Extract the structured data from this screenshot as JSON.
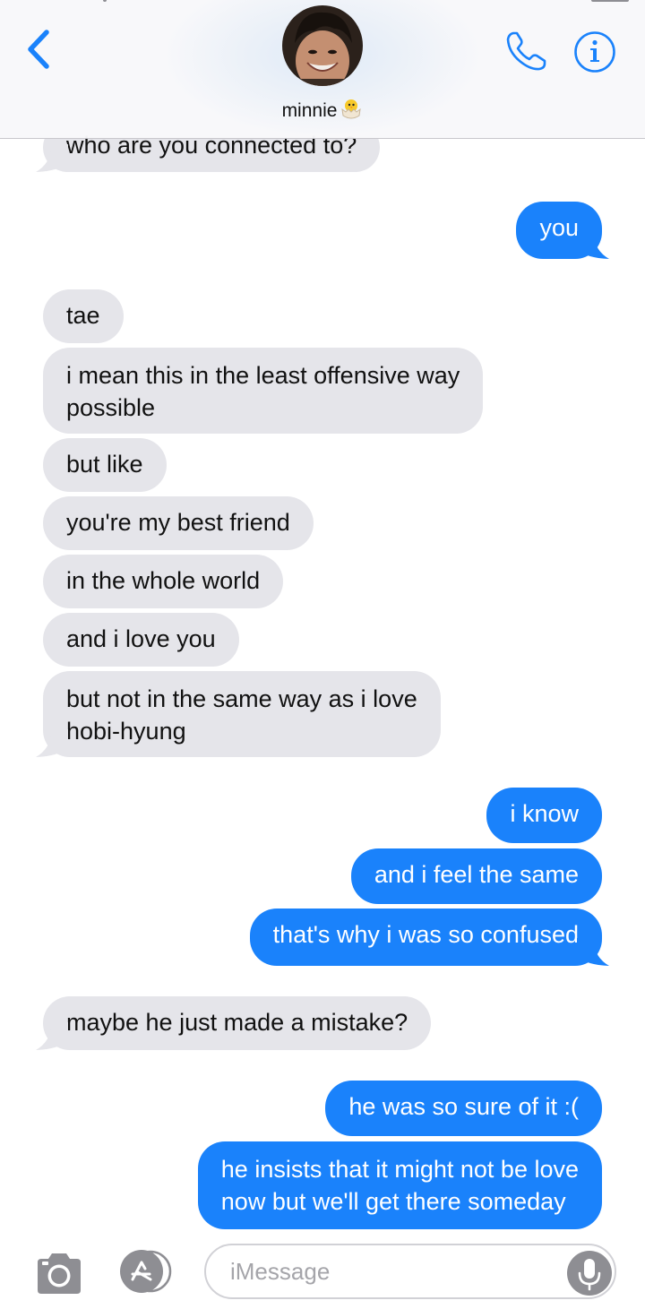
{
  "header": {
    "contact_name": "minnie",
    "contact_emoji": "🐣",
    "back_icon": "chevron-left-icon",
    "call_icon": "phone-icon",
    "info_icon": "info-icon",
    "accent_color": "#1a82fb"
  },
  "messages": [
    {
      "direction": "incoming",
      "lines": [
        "who are you connected to?"
      ]
    },
    {
      "direction": "outgoing",
      "lines": [
        "you"
      ]
    },
    {
      "direction": "incoming",
      "lines": [
        "tae"
      ]
    },
    {
      "direction": "incoming",
      "lines": [
        "i mean this in the least offensive way",
        "possible"
      ]
    },
    {
      "direction": "incoming",
      "lines": [
        "but like"
      ]
    },
    {
      "direction": "incoming",
      "lines": [
        "you're my best friend"
      ]
    },
    {
      "direction": "incoming",
      "lines": [
        "in the whole world"
      ]
    },
    {
      "direction": "incoming",
      "lines": [
        "and i love you"
      ]
    },
    {
      "direction": "incoming",
      "lines": [
        "but not in the same way as i love",
        "hobi-hyung"
      ]
    },
    {
      "direction": "outgoing",
      "lines": [
        "i know"
      ]
    },
    {
      "direction": "outgoing",
      "lines": [
        "and i feel the same"
      ]
    },
    {
      "direction": "outgoing",
      "lines": [
        "that's why i was so confused"
      ]
    },
    {
      "direction": "incoming",
      "lines": [
        "maybe he just made a mistake?"
      ]
    },
    {
      "direction": "outgoing",
      "lines": [
        "he was so sure of it :("
      ]
    },
    {
      "direction": "outgoing",
      "lines": [
        "he insists that it might not be love",
        "now but we'll get there someday"
      ]
    }
  ],
  "composer": {
    "placeholder": "iMessage",
    "value": "",
    "camera_icon": "camera-icon",
    "apps_icon": "app-store-icon",
    "mic_icon": "microphone-icon"
  },
  "colors": {
    "incoming_bubble": "#e5e5ea",
    "outgoing_bubble": "#1a82fb",
    "incoming_text": "#111111",
    "outgoing_text": "#ffffff"
  }
}
